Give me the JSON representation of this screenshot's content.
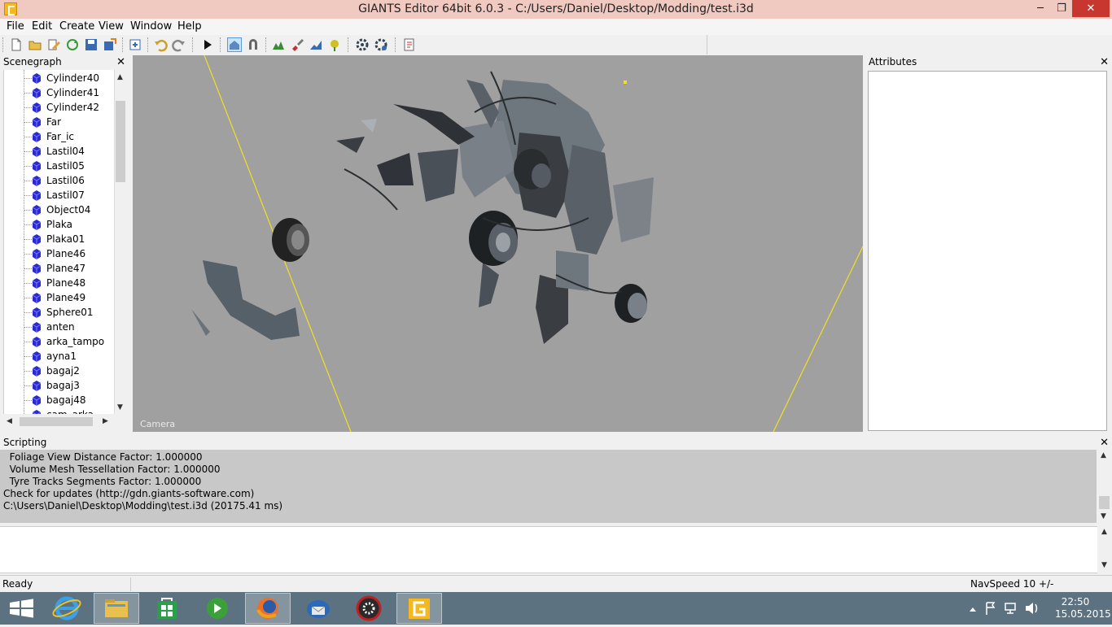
{
  "window": {
    "title": "GIANTS Editor 64bit 6.0.3 - C:/Users/Daniel/Desktop/Modding/test.i3d",
    "minimize": "─",
    "maximize": "❐",
    "close": "✕"
  },
  "menu": [
    "File",
    "Edit",
    "Create",
    "View",
    "Window",
    "Help"
  ],
  "toolbar": {
    "icons": [
      "new-file-icon",
      "open-file-icon",
      "edit-icon",
      "refresh-icon",
      "save-icon",
      "export-icon",
      "import-icon",
      "undo-icon",
      "redo-icon",
      "play-icon",
      "home-camera-icon",
      "magnet-icon",
      "tree-tool-icon",
      "paint-icon",
      "terrain-tool-icon",
      "foliage-icon",
      "settings-icon",
      "settings-2-icon",
      "script-icon"
    ]
  },
  "scenegraph": {
    "title": "Scenegraph",
    "close": "✕",
    "items": [
      "Cylinder40",
      "Cylinder41",
      "Cylinder42",
      "Far",
      "Far_ic",
      "Lastil04",
      "Lastil05",
      "Lastil06",
      "Lastil07",
      "Object04",
      "Plaka",
      "Plaka01",
      "Plane46",
      "Plane47",
      "Plane48",
      "Plane49",
      "Sphere01",
      "anten",
      "arka_tampo",
      "ayna1",
      "bagaj2",
      "bagaj3",
      "bagaj48",
      "cam_arka"
    ]
  },
  "viewport": {
    "camera_label": "Camera"
  },
  "attributes": {
    "title": "Attributes",
    "close": "✕"
  },
  "scripting": {
    "title": "Scripting",
    "close": "✕",
    "lines": [
      "  Foliage View Distance Factor: 1.000000",
      "  Volume Mesh Tessellation Factor: 1.000000",
      "  Tyre Tracks Segments Factor: 1.000000",
      "Check for updates (http://gdn.giants-software.com)",
      "C:\\Users\\Daniel\\Desktop\\Modding\\test.i3d (20175.41 ms)"
    ]
  },
  "status": {
    "left": "Ready",
    "right": "NavSpeed 10 +/-"
  },
  "taskbar": {
    "apps": [
      "start-icon",
      "internet-explorer-icon",
      "file-explorer-icon",
      "store-icon",
      "media-player-icon",
      "firefox-icon",
      "thunderbird-icon",
      "game-app-icon",
      "giants-editor-icon"
    ],
    "time": "22:50",
    "date": "15.05.2015"
  }
}
